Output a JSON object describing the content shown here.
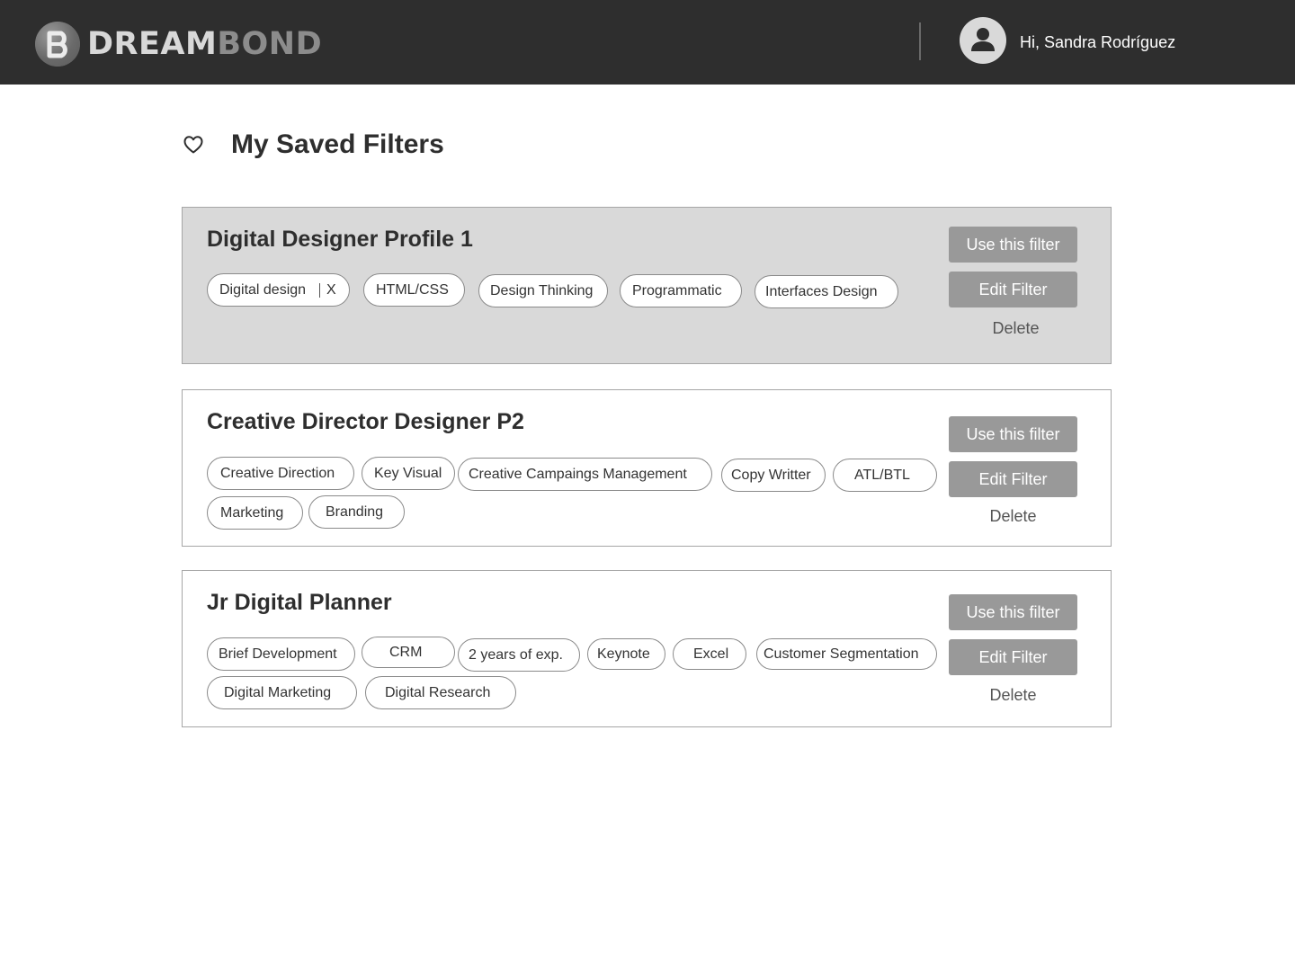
{
  "header": {
    "logo_primary": "DREAM",
    "logo_secondary": "BOND",
    "greeting": "Hi, Sandra Rodríguez"
  },
  "page": {
    "title": "My Saved Filters"
  },
  "filters": [
    {
      "title": "Digital Designer Profile 1",
      "tags": [
        "Digital design",
        "HTML/CSS",
        "Design Thinking",
        "Programmatic",
        "Interfaces Design"
      ],
      "remove_label": "X"
    },
    {
      "title": "Creative Director Designer P2",
      "tags": [
        "Creative Direction",
        "Key Visual",
        "Creative Campaings Management",
        "Copy Writter",
        "ATL/BTL",
        "Marketing",
        "Branding"
      ]
    },
    {
      "title": "Jr Digital Planner",
      "tags": [
        "Brief Development",
        "CRM",
        "2 years of exp.",
        "Keynote",
        "Excel",
        "Customer Segmentation",
        "Digital Marketing",
        "Digital Research"
      ]
    }
  ],
  "actions": {
    "use_label": "Use this filter",
    "edit_label": "Edit Filter",
    "delete_label": "Delete"
  },
  "colors": {
    "header_bg": "#2e2e2e",
    "selected_card_bg": "#d9d9d9",
    "button_bg": "#999999"
  }
}
